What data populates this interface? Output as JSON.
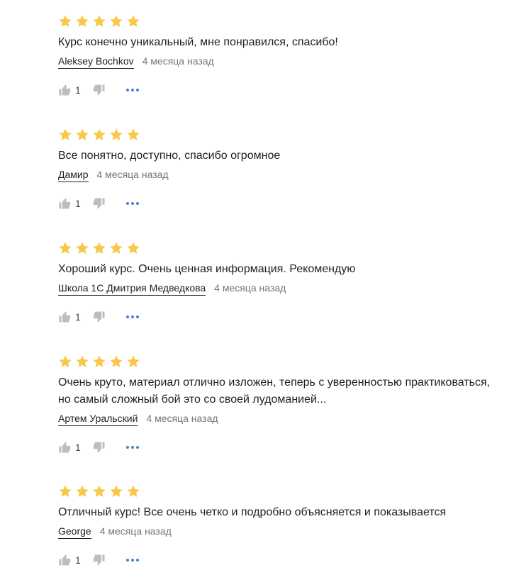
{
  "reviews": [
    {
      "rating": 5,
      "text": "Курс конечно уникальный, мне понравился, спасибо!",
      "author": "Aleksey Bochkov",
      "date": "4 месяца назад",
      "likes": "1"
    },
    {
      "rating": 5,
      "text": "Все понятно, доступно, спасибо огромное",
      "author": "Дамир",
      "date": "4 месяца назад",
      "likes": "1"
    },
    {
      "rating": 5,
      "text": "Хороший курс. Очень ценная информация. Рекомендую",
      "author": "Школа 1С Дмитрия Медведкова",
      "date": "4 месяца назад",
      "likes": "1"
    },
    {
      "rating": 5,
      "text": "Очень круто, материал отлично изложен, теперь с уверенностью практиковаться,\nно самый сложный бой это со своей лудоманией...",
      "author": "Артем Уральский",
      "date": "4 месяца назад",
      "likes": "1"
    },
    {
      "rating": 5,
      "text": "Отличный курс! Все очень четко и подробно объясняется и показывается",
      "author": "George",
      "date": "4 месяца назад",
      "likes": "1"
    }
  ],
  "colors": {
    "star": "#f8c84a",
    "text": "#212121",
    "date": "#757575",
    "thumb": "#bdbdbd",
    "dots": "#4a7fd6"
  },
  "icons": {
    "star": "star-icon",
    "like": "thumb-up-icon",
    "dislike": "thumb-down-icon",
    "more": "more-horizontal-icon"
  }
}
